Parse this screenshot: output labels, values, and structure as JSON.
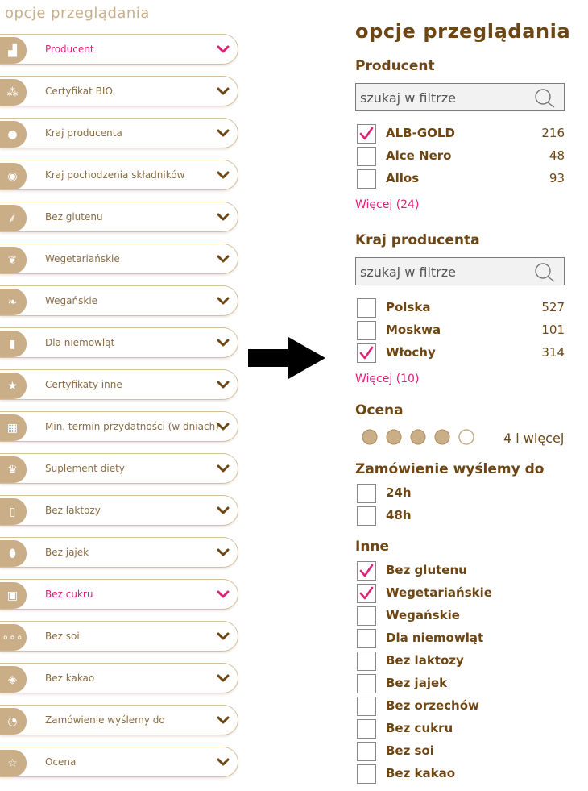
{
  "left_panel": {
    "title": "opcje przeglądania",
    "items": [
      {
        "label": "Producent",
        "icon": "factory-icon",
        "glyph": "▟",
        "active": true
      },
      {
        "label": "Certyfikat BIO",
        "icon": "bio-leaf-icon",
        "glyph": "⁂",
        "active": false
      },
      {
        "label": "Kraj producenta",
        "icon": "map-pin-icon",
        "glyph": "●",
        "active": false
      },
      {
        "label": "Kraj pochodzenia składników",
        "icon": "globe-icon",
        "glyph": "◉",
        "active": false
      },
      {
        "label": "Bez glutenu",
        "icon": "wheat-icon",
        "glyph": "⸙",
        "active": false
      },
      {
        "label": "Wegetariańskie",
        "icon": "leaf-icon",
        "glyph": "❦",
        "active": false
      },
      {
        "label": "Wegańskie",
        "icon": "vegan-leaf-icon",
        "glyph": "❧",
        "active": false
      },
      {
        "label": "Dla niemowląt",
        "icon": "baby-bottle-icon",
        "glyph": "▮",
        "active": false
      },
      {
        "label": "Certyfikaty inne",
        "icon": "star-icon",
        "glyph": "★",
        "active": false
      },
      {
        "label": "Min. termin przydatności (w dniach)",
        "icon": "calendar-icon",
        "glyph": "▦",
        "active": false
      },
      {
        "label": "Suplement diety",
        "icon": "trophy-icon",
        "glyph": "♛",
        "active": false
      },
      {
        "label": "Bez laktozy",
        "icon": "milk-bottle-icon",
        "glyph": "▯",
        "active": false
      },
      {
        "label": "Bez jajek",
        "icon": "egg-icon",
        "glyph": "⬮",
        "active": false
      },
      {
        "label": "Bez cukru",
        "icon": "sugar-cubes-icon",
        "glyph": "▣",
        "active": true
      },
      {
        "label": "Bez soi",
        "icon": "soy-pod-icon",
        "glyph": "∘∘∘",
        "active": false
      },
      {
        "label": "Bez kakao",
        "icon": "cocoa-icon",
        "glyph": "◈",
        "active": false
      },
      {
        "label": "Zamówienie wyślemy do",
        "icon": "clock-icon",
        "glyph": "◔",
        "active": false
      },
      {
        "label": "Ocena",
        "icon": "star-outline-icon",
        "glyph": "☆",
        "active": false
      }
    ]
  },
  "right_panel": {
    "title": "opcje przeglądania",
    "producer": {
      "title": "Producent",
      "search_placeholder": "szukaj w filtrze",
      "options": [
        {
          "label": "ALB-GOLD",
          "count": "216",
          "checked": true
        },
        {
          "label": "Alce Nero",
          "count": "48",
          "checked": false
        },
        {
          "label": "Allos",
          "count": "93",
          "checked": false
        }
      ],
      "more": "Więcej (24)"
    },
    "country": {
      "title": "Kraj producenta",
      "search_placeholder": "szukaj w filtrze",
      "options": [
        {
          "label": "Polska",
          "count": "527",
          "checked": false
        },
        {
          "label": "Moskwa",
          "count": "101",
          "checked": false
        },
        {
          "label": "Włochy",
          "count": "314",
          "checked": true
        }
      ],
      "more": "Więcej (10)"
    },
    "rating": {
      "title": "Ocena",
      "stars_filled": 4,
      "stars_total": 5,
      "label": "4 i więcej"
    },
    "shipping": {
      "title": "Zamówienie wyślemy do",
      "options": [
        {
          "label": "24h",
          "checked": false
        },
        {
          "label": "48h",
          "checked": false
        }
      ]
    },
    "other": {
      "title": "Inne",
      "options": [
        {
          "label": "Bez glutenu",
          "checked": true
        },
        {
          "label": "Wegetariańskie",
          "checked": true
        },
        {
          "label": "Wegańskie",
          "checked": false
        },
        {
          "label": "Dla niemowląt",
          "checked": false
        },
        {
          "label": "Bez laktozy",
          "checked": false
        },
        {
          "label": "Bez jajek",
          "checked": false
        },
        {
          "label": "Bez orzechów",
          "checked": false
        },
        {
          "label": "Bez cukru",
          "checked": false
        },
        {
          "label": "Bez soi",
          "checked": false
        },
        {
          "label": "Bez kakao",
          "checked": false
        }
      ]
    }
  },
  "colors": {
    "accent": "#e0217a",
    "brown": "#6d4614",
    "tan": "#c9ae87",
    "border": "#d8c09c",
    "star": "#c9ae87"
  }
}
